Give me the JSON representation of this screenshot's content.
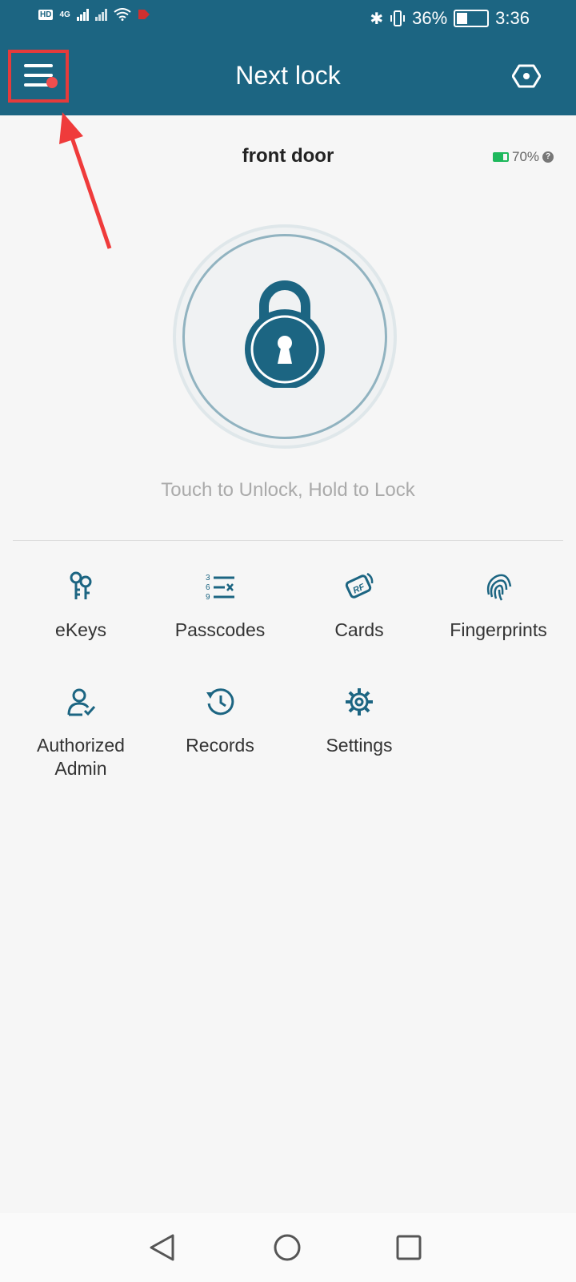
{
  "status_bar": {
    "hd": "HD",
    "net": "4G",
    "battery": "36%",
    "battery_level": 0.36,
    "time": "3:36"
  },
  "header": {
    "title": "Next lock",
    "menu_icon": "hamburger-menu-icon",
    "settings_icon": "eye-icon"
  },
  "lock": {
    "name": "front door",
    "battery": "70%",
    "battery_level": 0.7,
    "hint": "Touch to Unlock, Hold to Lock"
  },
  "functions": [
    {
      "label": "eKeys",
      "icon": "keys-icon"
    },
    {
      "label": "Passcodes",
      "icon": "passcode-list-icon"
    },
    {
      "label": "Cards",
      "icon": "rf-card-icon"
    },
    {
      "label": "Fingerprints",
      "icon": "fingerprint-icon"
    },
    {
      "label": "Authorized\nAdmin",
      "icon": "admin-user-icon"
    },
    {
      "label": "Records",
      "icon": "history-icon"
    },
    {
      "label": "Settings",
      "icon": "gear-icon"
    }
  ],
  "nav": {
    "back_icon": "back-triangle-icon",
    "home_icon": "home-circle-icon",
    "recents_icon": "recents-square-icon"
  },
  "colors": {
    "brand": "#1c6582",
    "highlight": "#e53b3b",
    "battery_green": "#1eb85c"
  }
}
